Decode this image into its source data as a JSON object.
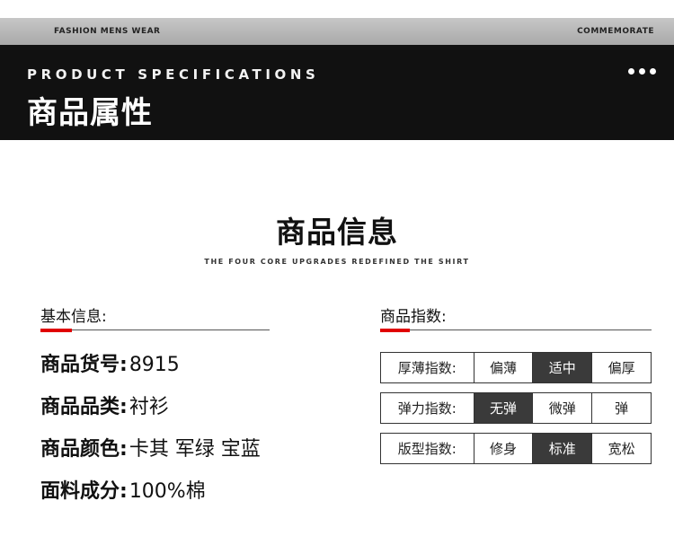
{
  "header": {
    "top_left": "FASHION MENS WEAR",
    "top_right": "COMMEMORATE",
    "banner_en": "PRODUCT SPECIFICATIONS",
    "banner_zh": "商品属性"
  },
  "section": {
    "title": "商品信息",
    "subtitle": "THE FOUR CORE UPGRADES REDEFINED THE SHIRT"
  },
  "basic": {
    "heading": "基本信息:",
    "rows": [
      {
        "label": "商品货号:",
        "value": "8915"
      },
      {
        "label": "商品品类:",
        "value": "衬衫"
      },
      {
        "label": "商品颜色:",
        "value": "卡其 军绿 宝蓝"
      },
      {
        "label": "面料成分:",
        "value": "100%棉"
      }
    ]
  },
  "indices": {
    "heading": "商品指数:",
    "rows": [
      {
        "label": "厚薄指数:",
        "options": [
          "偏薄",
          "适中",
          "偏厚"
        ],
        "selected": 1
      },
      {
        "label": "弹力指数:",
        "options": [
          "无弹",
          "微弹",
          "弹"
        ],
        "selected": 0
      },
      {
        "label": "版型指数:",
        "options": [
          "修身",
          "标准",
          "宽松"
        ],
        "selected": 1
      }
    ]
  },
  "colors": {
    "accent": "#e00000",
    "banner": "#111111",
    "selected_cell": "#3a3a3a"
  }
}
